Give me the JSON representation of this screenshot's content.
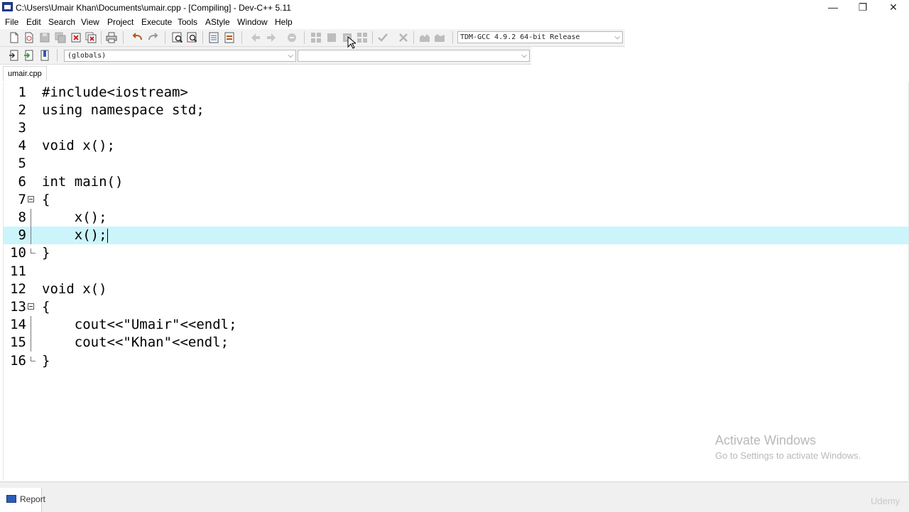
{
  "window": {
    "title": "C:\\Users\\Umair Khan\\Documents\\umair.cpp - [Compiling] - Dev-C++ 5.11",
    "minimize": "—",
    "restore": "❐",
    "close": "✕"
  },
  "menu": [
    "File",
    "Edit",
    "Search",
    "View",
    "Project",
    "Execute",
    "Tools",
    "AStyle",
    "Window",
    "Help"
  ],
  "toolbar": {
    "compiler": "TDM-GCC 4.9.2 64-bit Release",
    "class_combo": "(globals)",
    "member_combo": ""
  },
  "tabs": [
    "umair.cpp"
  ],
  "editor": {
    "lines": [
      {
        "n": "1",
        "text": "#include<iostream>"
      },
      {
        "n": "2",
        "text": "using namespace std;"
      },
      {
        "n": "3",
        "text": ""
      },
      {
        "n": "4",
        "text": "void x();"
      },
      {
        "n": "5",
        "text": ""
      },
      {
        "n": "6",
        "text": "int main()"
      },
      {
        "n": "7",
        "text": "{"
      },
      {
        "n": "8",
        "text": "    x();"
      },
      {
        "n": "9",
        "text": "    x();"
      },
      {
        "n": "10",
        "text": "}"
      },
      {
        "n": "11",
        "text": ""
      },
      {
        "n": "12",
        "text": "void x()"
      },
      {
        "n": "13",
        "text": "{"
      },
      {
        "n": "14",
        "text": "    cout<<\"Umair\"<<endl;"
      },
      {
        "n": "15",
        "text": "    cout<<\"Khan\"<<endl;"
      },
      {
        "n": "16",
        "text": "}"
      }
    ],
    "active_line": "9"
  },
  "watermark": {
    "title": "Activate Windows",
    "subtitle": "Go to Settings to activate Windows."
  },
  "bottom": {
    "report_label": "Report",
    "brand": "Udemy"
  },
  "colors": {
    "active_line": "#cbf4fb",
    "toolbar_bg": "#f2f2f2"
  }
}
